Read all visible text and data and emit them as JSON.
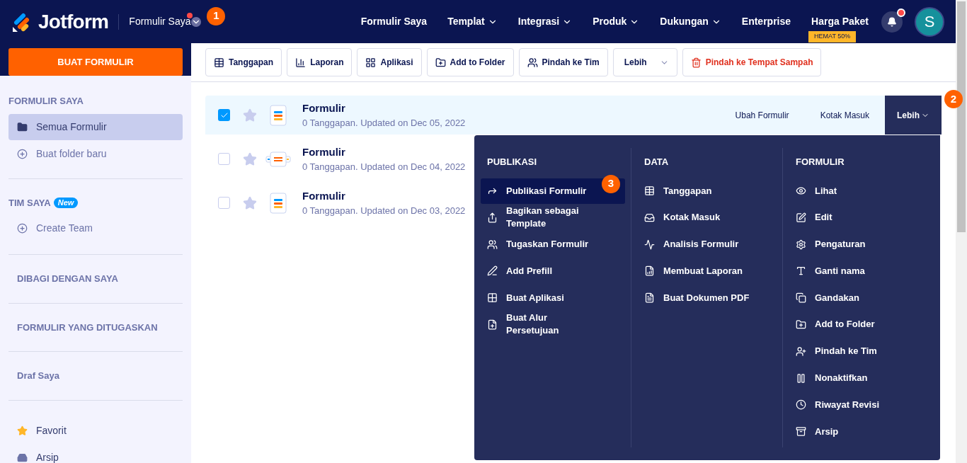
{
  "header": {
    "logo": "Jotform",
    "context": "Formulir Saya",
    "context_alert": true,
    "marker": "1",
    "nav": [
      {
        "label": "Formulir Saya",
        "dropdown": false
      },
      {
        "label": "Templat",
        "dropdown": true
      },
      {
        "label": "Integrasi",
        "dropdown": true
      },
      {
        "label": "Produk",
        "dropdown": true
      },
      {
        "label": "Dukungan",
        "dropdown": true
      },
      {
        "label": "Enterprise",
        "dropdown": false
      },
      {
        "label": "Harga Paket",
        "dropdown": false
      }
    ],
    "promo": "HEMAT 50%",
    "notification": true,
    "avatar": "S"
  },
  "sidebar": {
    "create_button": "BUAT FORMULIR",
    "groups": [
      {
        "heading": "FORMULIR SAYA",
        "items": [
          {
            "label": "Semua Formulir",
            "kind": "folder",
            "selected": true
          },
          {
            "label": "Buat folder baru",
            "kind": "add",
            "selected": false
          }
        ]
      },
      {
        "heading": "TIM SAYA",
        "badge": "New",
        "items": [
          {
            "label": "Create Team",
            "kind": "add",
            "selected": false
          }
        ]
      },
      {
        "heading": "DIBAGI DENGAN SAYA"
      },
      {
        "heading": "FORMULIR YANG DITUGASKAN"
      },
      {
        "heading": "Draf Saya"
      },
      {
        "items": [
          {
            "label": "Favorit",
            "kind": "favorite",
            "selected": false
          },
          {
            "label": "Arsip",
            "kind": "archive",
            "selected": false
          }
        ]
      }
    ]
  },
  "toolbar": [
    {
      "label": "Tanggapan",
      "kind": "table"
    },
    {
      "label": "Laporan",
      "kind": "report"
    },
    {
      "label": "Aplikasi",
      "kind": "apps"
    },
    {
      "label": "Add to Folder",
      "kind": "folder"
    },
    {
      "label": "Pindah ke Tim",
      "kind": "team"
    },
    {
      "label": "Lebih",
      "kind": "more"
    },
    {
      "label": "Pindah ke Tempat Sampah",
      "kind": "trash"
    }
  ],
  "forms": [
    {
      "title": "Formulir",
      "meta": "0 Tanggapan. Updated on Dec 05, 2022",
      "checked": true,
      "selected": true,
      "kind": "form"
    },
    {
      "title": "Formulir",
      "meta": "0 Tanggapan. Updated on Dec 04, 2022",
      "checked": false,
      "selected": false,
      "kind": "card"
    },
    {
      "title": "Formulir",
      "meta": "0 Tanggapan. Updated on Dec 03, 2022",
      "checked": false,
      "selected": false,
      "kind": "form"
    }
  ],
  "row_actions": {
    "edit": "Ubah Formulir",
    "inbox": "Kotak Masuk",
    "more": "Lebih",
    "marker": "2"
  },
  "menu": {
    "marker": "3",
    "columns": [
      {
        "title": "PUBLIKASI",
        "items": [
          {
            "label": "Publikasi Formulir",
            "selected": true
          },
          {
            "label": "Bagikan sebagai Template",
            "selected": false
          },
          {
            "label": "Tugaskan Formulir",
            "selected": false
          },
          {
            "label": "Add Prefill",
            "selected": false
          },
          {
            "label": "Buat Aplikasi",
            "selected": false
          },
          {
            "label": "Buat Alur Persetujuan",
            "selected": false
          }
        ]
      },
      {
        "title": "DATA",
        "items": [
          {
            "label": "Tanggapan",
            "selected": false
          },
          {
            "label": "Kotak Masuk",
            "selected": false
          },
          {
            "label": "Analisis Formulir",
            "selected": false
          },
          {
            "label": "Membuat Laporan",
            "selected": false
          },
          {
            "label": "Buat Dokumen PDF",
            "selected": false
          }
        ]
      },
      {
        "title": "FORMULIR",
        "items": [
          {
            "label": "Lihat",
            "selected": false
          },
          {
            "label": "Edit",
            "selected": false
          },
          {
            "label": "Pengaturan",
            "selected": false
          },
          {
            "label": "Ganti nama",
            "selected": false
          },
          {
            "label": "Gandakan",
            "selected": false
          },
          {
            "label": "Add to Folder",
            "selected": false
          },
          {
            "label": "Pindah ke Tim",
            "selected": false
          },
          {
            "label": "Nonaktifkan",
            "selected": false
          },
          {
            "label": "Riwayat Revisi",
            "selected": false
          },
          {
            "label": "Arsip",
            "selected": false
          }
        ]
      }
    ]
  }
}
